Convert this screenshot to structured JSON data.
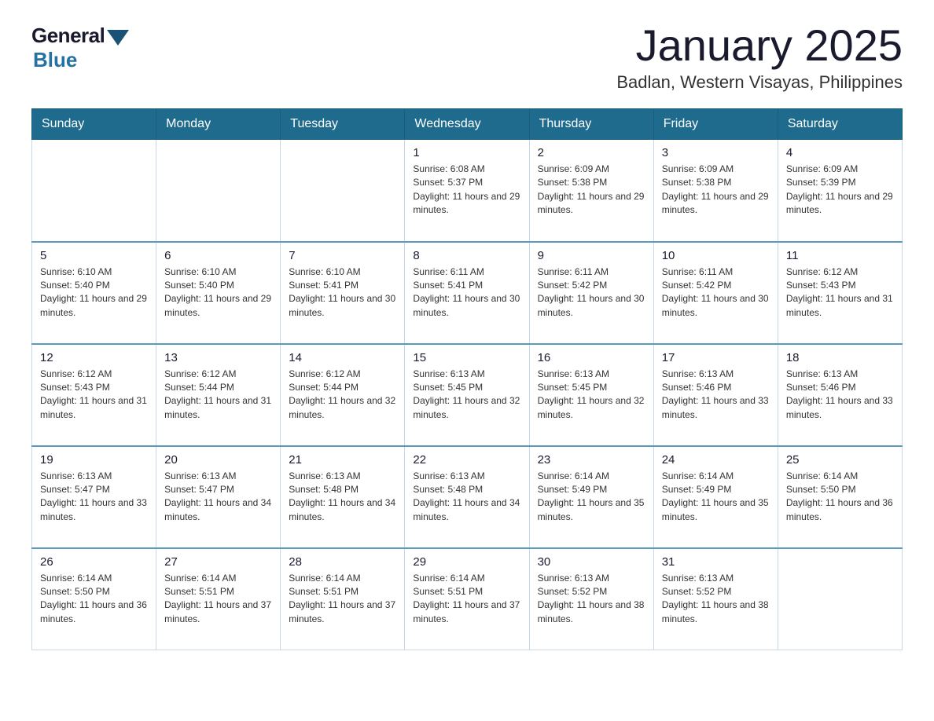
{
  "header": {
    "logo_general": "General",
    "logo_blue": "Blue",
    "month_title": "January 2025",
    "location": "Badlan, Western Visayas, Philippines"
  },
  "days_of_week": [
    "Sunday",
    "Monday",
    "Tuesday",
    "Wednesday",
    "Thursday",
    "Friday",
    "Saturday"
  ],
  "weeks": [
    {
      "days": [
        {
          "number": "",
          "info": ""
        },
        {
          "number": "",
          "info": ""
        },
        {
          "number": "",
          "info": ""
        },
        {
          "number": "1",
          "info": "Sunrise: 6:08 AM\nSunset: 5:37 PM\nDaylight: 11 hours and 29 minutes."
        },
        {
          "number": "2",
          "info": "Sunrise: 6:09 AM\nSunset: 5:38 PM\nDaylight: 11 hours and 29 minutes."
        },
        {
          "number": "3",
          "info": "Sunrise: 6:09 AM\nSunset: 5:38 PM\nDaylight: 11 hours and 29 minutes."
        },
        {
          "number": "4",
          "info": "Sunrise: 6:09 AM\nSunset: 5:39 PM\nDaylight: 11 hours and 29 minutes."
        }
      ]
    },
    {
      "days": [
        {
          "number": "5",
          "info": "Sunrise: 6:10 AM\nSunset: 5:40 PM\nDaylight: 11 hours and 29 minutes."
        },
        {
          "number": "6",
          "info": "Sunrise: 6:10 AM\nSunset: 5:40 PM\nDaylight: 11 hours and 29 minutes."
        },
        {
          "number": "7",
          "info": "Sunrise: 6:10 AM\nSunset: 5:41 PM\nDaylight: 11 hours and 30 minutes."
        },
        {
          "number": "8",
          "info": "Sunrise: 6:11 AM\nSunset: 5:41 PM\nDaylight: 11 hours and 30 minutes."
        },
        {
          "number": "9",
          "info": "Sunrise: 6:11 AM\nSunset: 5:42 PM\nDaylight: 11 hours and 30 minutes."
        },
        {
          "number": "10",
          "info": "Sunrise: 6:11 AM\nSunset: 5:42 PM\nDaylight: 11 hours and 30 minutes."
        },
        {
          "number": "11",
          "info": "Sunrise: 6:12 AM\nSunset: 5:43 PM\nDaylight: 11 hours and 31 minutes."
        }
      ]
    },
    {
      "days": [
        {
          "number": "12",
          "info": "Sunrise: 6:12 AM\nSunset: 5:43 PM\nDaylight: 11 hours and 31 minutes."
        },
        {
          "number": "13",
          "info": "Sunrise: 6:12 AM\nSunset: 5:44 PM\nDaylight: 11 hours and 31 minutes."
        },
        {
          "number": "14",
          "info": "Sunrise: 6:12 AM\nSunset: 5:44 PM\nDaylight: 11 hours and 32 minutes."
        },
        {
          "number": "15",
          "info": "Sunrise: 6:13 AM\nSunset: 5:45 PM\nDaylight: 11 hours and 32 minutes."
        },
        {
          "number": "16",
          "info": "Sunrise: 6:13 AM\nSunset: 5:45 PM\nDaylight: 11 hours and 32 minutes."
        },
        {
          "number": "17",
          "info": "Sunrise: 6:13 AM\nSunset: 5:46 PM\nDaylight: 11 hours and 33 minutes."
        },
        {
          "number": "18",
          "info": "Sunrise: 6:13 AM\nSunset: 5:46 PM\nDaylight: 11 hours and 33 minutes."
        }
      ]
    },
    {
      "days": [
        {
          "number": "19",
          "info": "Sunrise: 6:13 AM\nSunset: 5:47 PM\nDaylight: 11 hours and 33 minutes."
        },
        {
          "number": "20",
          "info": "Sunrise: 6:13 AM\nSunset: 5:47 PM\nDaylight: 11 hours and 34 minutes."
        },
        {
          "number": "21",
          "info": "Sunrise: 6:13 AM\nSunset: 5:48 PM\nDaylight: 11 hours and 34 minutes."
        },
        {
          "number": "22",
          "info": "Sunrise: 6:13 AM\nSunset: 5:48 PM\nDaylight: 11 hours and 34 minutes."
        },
        {
          "number": "23",
          "info": "Sunrise: 6:14 AM\nSunset: 5:49 PM\nDaylight: 11 hours and 35 minutes."
        },
        {
          "number": "24",
          "info": "Sunrise: 6:14 AM\nSunset: 5:49 PM\nDaylight: 11 hours and 35 minutes."
        },
        {
          "number": "25",
          "info": "Sunrise: 6:14 AM\nSunset: 5:50 PM\nDaylight: 11 hours and 36 minutes."
        }
      ]
    },
    {
      "days": [
        {
          "number": "26",
          "info": "Sunrise: 6:14 AM\nSunset: 5:50 PM\nDaylight: 11 hours and 36 minutes."
        },
        {
          "number": "27",
          "info": "Sunrise: 6:14 AM\nSunset: 5:51 PM\nDaylight: 11 hours and 37 minutes."
        },
        {
          "number": "28",
          "info": "Sunrise: 6:14 AM\nSunset: 5:51 PM\nDaylight: 11 hours and 37 minutes."
        },
        {
          "number": "29",
          "info": "Sunrise: 6:14 AM\nSunset: 5:51 PM\nDaylight: 11 hours and 37 minutes."
        },
        {
          "number": "30",
          "info": "Sunrise: 6:13 AM\nSunset: 5:52 PM\nDaylight: 11 hours and 38 minutes."
        },
        {
          "number": "31",
          "info": "Sunrise: 6:13 AM\nSunset: 5:52 PM\nDaylight: 11 hours and 38 minutes."
        },
        {
          "number": "",
          "info": ""
        }
      ]
    }
  ]
}
